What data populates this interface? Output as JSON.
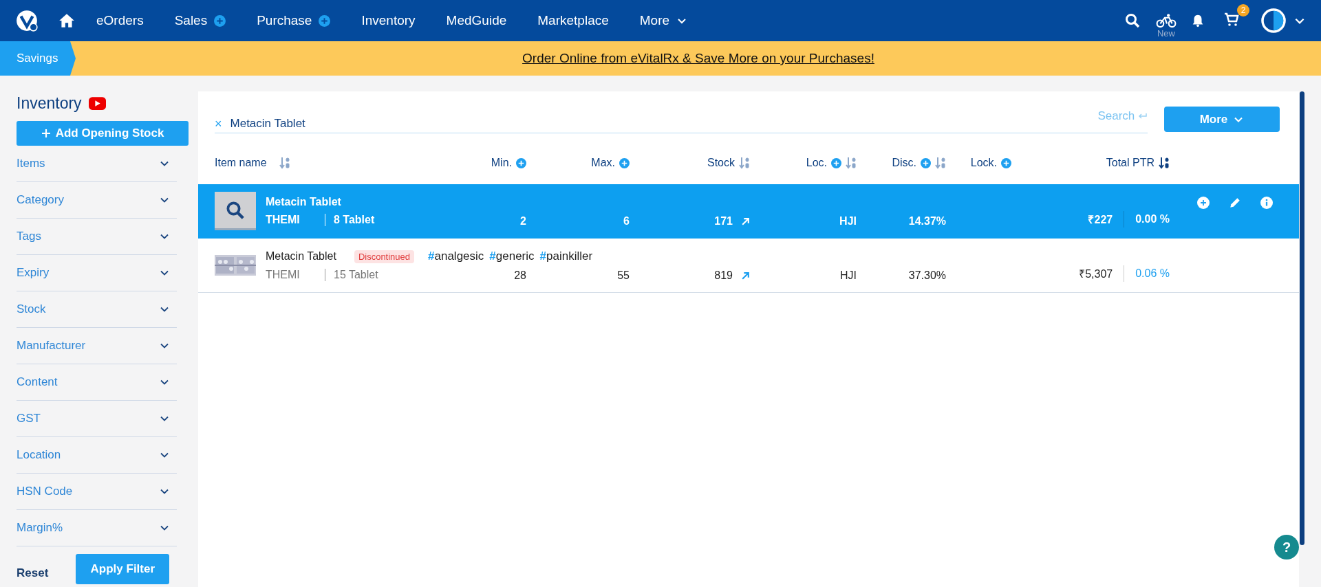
{
  "nav": {
    "items": [
      {
        "label": "eOrders",
        "plus": false
      },
      {
        "label": "Sales",
        "plus": true
      },
      {
        "label": "Purchase",
        "plus": true
      },
      {
        "label": "Inventory",
        "plus": false
      },
      {
        "label": "MedGuide",
        "plus": false
      },
      {
        "label": "Marketplace",
        "plus": false
      },
      {
        "label": "More",
        "plus": false,
        "dropdown": true
      }
    ],
    "new_label": "New",
    "cart_count": "2"
  },
  "banner": {
    "tab": "Savings",
    "message": "Order Online from eVitalRx & Save More on your Purchases!"
  },
  "sidebar": {
    "title": "Inventory",
    "add_button": "Add Opening Stock",
    "filters": [
      "Items",
      "Category",
      "Tags",
      "Expiry",
      "Stock",
      "Manufacturer",
      "Content",
      "GST",
      "Location",
      "HSN Code",
      "Margin%"
    ],
    "reset": "Reset",
    "apply": "Apply Filter"
  },
  "search": {
    "clear": "×",
    "value": "Metacin Tablet",
    "hint": "Search",
    "more_button": "More"
  },
  "table": {
    "columns": [
      {
        "label": "Item name",
        "plus": false,
        "sortable": true,
        "sort_active": false
      },
      {
        "label": "Min.",
        "plus": true,
        "sortable": false
      },
      {
        "label": "Max.",
        "plus": true,
        "sortable": false
      },
      {
        "label": "Stock",
        "plus": false,
        "sortable": true,
        "sort_active": false
      },
      {
        "label": "Loc.",
        "plus": true,
        "sortable": true,
        "sort_active": false
      },
      {
        "label": "Disc.",
        "plus": true,
        "sortable": true,
        "sort_active": false
      },
      {
        "label": "Lock.",
        "plus": true,
        "sortable": false
      },
      {
        "label": "Total PTR",
        "plus": false,
        "sortable": true,
        "sort_active": true
      }
    ],
    "rows": [
      {
        "selected": true,
        "has_image": false,
        "name": "Metacin Tablet",
        "manufacturer": "THEMI",
        "pack": "8 Tablet",
        "min": "2",
        "max": "6",
        "stock": "171",
        "loc": "HJI",
        "disc": "14.37%",
        "ptr": "₹227",
        "ptr_pct": "0.00 %",
        "actions": true
      },
      {
        "selected": false,
        "has_image": true,
        "name": "Metacin Tablet",
        "badge": "Discontinued",
        "tags": [
          {
            "hash": "#",
            "name": "analgesic"
          },
          {
            "hash": "#",
            "name": "generic"
          },
          {
            "hash": "#",
            "name": "painkiller"
          }
        ],
        "manufacturer": "THEMI",
        "pack": "15 Tablet",
        "min": "28",
        "max": "55",
        "stock": "819",
        "loc": "HJI",
        "disc": "37.30%",
        "ptr": "₹5,307",
        "ptr_pct": "0.06 %",
        "actions": false
      }
    ]
  },
  "help": "?"
}
